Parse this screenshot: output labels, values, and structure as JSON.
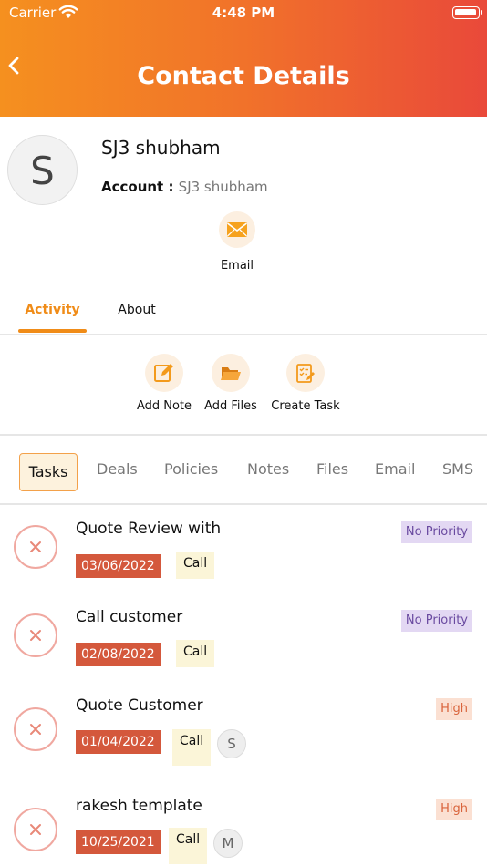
{
  "status_bar": {
    "carrier": "Carrier",
    "time": "4:48 PM"
  },
  "header": {
    "title": "Contact Details"
  },
  "contact": {
    "avatar_initial": "S",
    "name": "SJ3 shubham",
    "account_label": "Account : ",
    "account_value": "SJ3 shubham",
    "email_label": "Email"
  },
  "tabs": [
    {
      "label": "Activity",
      "active": true
    },
    {
      "label": "About",
      "active": false
    }
  ],
  "actions": [
    {
      "label": "Add Note",
      "icon": "edit-note-icon"
    },
    {
      "label": "Add Files",
      "icon": "folder-open-icon"
    },
    {
      "label": "Create Task",
      "icon": "task-checklist-icon"
    }
  ],
  "filters": [
    "Tasks",
    "Deals",
    "Policies",
    "Notes",
    "Files",
    "Email",
    "SMS"
  ],
  "active_filter": "Tasks",
  "tasks": [
    {
      "title": "Quote Review with",
      "date": "03/06/2022",
      "type": "Call",
      "user_initial": "",
      "priority": "No Priority"
    },
    {
      "title": "Call customer",
      "date": "02/08/2022",
      "type": "Call",
      "user_initial": "",
      "priority": "No Priority"
    },
    {
      "title": "Quote Customer",
      "date": "01/04/2022",
      "type": "Call",
      "user_initial": "S",
      "priority": "High"
    },
    {
      "title": "rakesh template",
      "date": "10/25/2021",
      "type": "Call",
      "user_initial": "M",
      "priority": "High"
    }
  ],
  "colors": {
    "header_gradient_start": "#f5901f",
    "header_gradient_end": "#e9493a",
    "accent": "#f08c18",
    "date_badge": "#d4583c",
    "priority_none_bg": "#e3d8f3",
    "priority_high_bg": "#fbe0d2"
  }
}
